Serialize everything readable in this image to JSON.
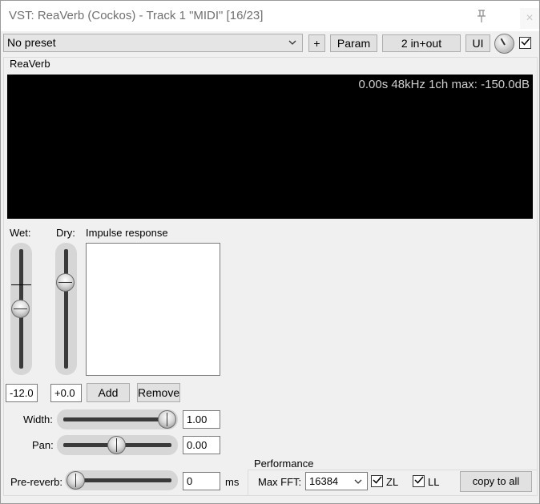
{
  "window": {
    "title": "VST: ReaVerb (Cockos) - Track 1 \"MIDI\" [16/23]",
    "close_glyph": "×"
  },
  "toolbar": {
    "preset_value": "No preset",
    "plus_label": "+",
    "param_label": "Param",
    "io_label": "2 in+out",
    "ui_label": "UI",
    "enabled_checked": true
  },
  "plugin": {
    "group_label": "ReaVerb",
    "display_status": "0.00s 48kHz 1ch max: -150.0dB"
  },
  "wet": {
    "label": "Wet:",
    "value": "-12.0",
    "level": 0.5
  },
  "dry": {
    "label": "Dry:",
    "value": "+0.0",
    "level": 0.73
  },
  "impulse": {
    "label": "Impulse response",
    "add_label": "Add",
    "remove_label": "Remove"
  },
  "width": {
    "label": "Width:",
    "value": "1.00",
    "level": 1.0
  },
  "pan": {
    "label": "Pan:",
    "value": "0.00",
    "level": 0.5
  },
  "prereverb": {
    "label": "Pre-reverb:",
    "value": "0",
    "unit": "ms",
    "level": 0.0
  },
  "performance": {
    "group_label": "Performance",
    "max_fft_label": "Max FFT:",
    "max_fft_value": "16384",
    "zl_label": "ZL",
    "zl_checked": true,
    "ll_label": "LL",
    "ll_checked": true,
    "copy_label": "copy to all"
  },
  "icons": [
    "pin-icon",
    "close-icon",
    "chevron-down-icon",
    "knob-icon",
    "checkmark-icon"
  ]
}
